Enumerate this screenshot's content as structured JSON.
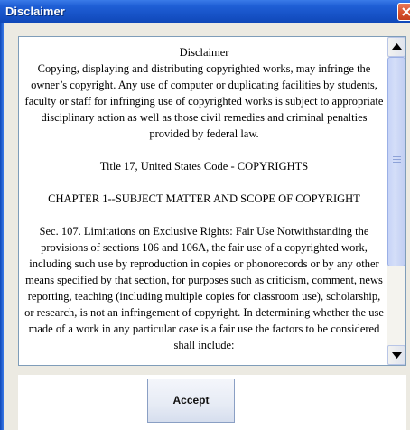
{
  "window": {
    "title": "Disclaimer"
  },
  "disclaimer": {
    "heading": "Disclaimer",
    "intro": "Copying, displaying and distributing copyrighted works, may infringe the owner’s copyright. Any use of computer or duplicating facilities by students, faculty or staff for infringing use of copyrighted works is subject to appropriate disciplinary action as well as those civil remedies and criminal penalties provided by federal law.",
    "title17": "Title 17, United States Code - COPYRIGHTS",
    "chapter": "CHAPTER 1--SUBJECT MATTER AND SCOPE OF COPYRIGHT",
    "section107": "Sec. 107. Limitations on Exclusive Rights: Fair Use Notwithstanding the provisions of sections 106 and 106A, the fair use of a copyrighted work, including such use by reproduction in copies or phonorecords or by any other means specified by that section, for purposes such as criticism, comment, news reporting, teaching (including multiple copies for classroom use), scholarship, or research, is not an infringement of copyright. In determining whether the use made of a work in any particular case is a fair use the factors to be considered shall include:"
  },
  "buttons": {
    "accept_label": "Accept"
  },
  "colors": {
    "titlebar": "#1f5fd6",
    "close": "#d9532f",
    "scroll_thumb": "#c6d3f7"
  },
  "icons": {
    "close": "close-icon",
    "scroll_up": "arrow-up-icon",
    "scroll_down": "arrow-down-icon"
  }
}
